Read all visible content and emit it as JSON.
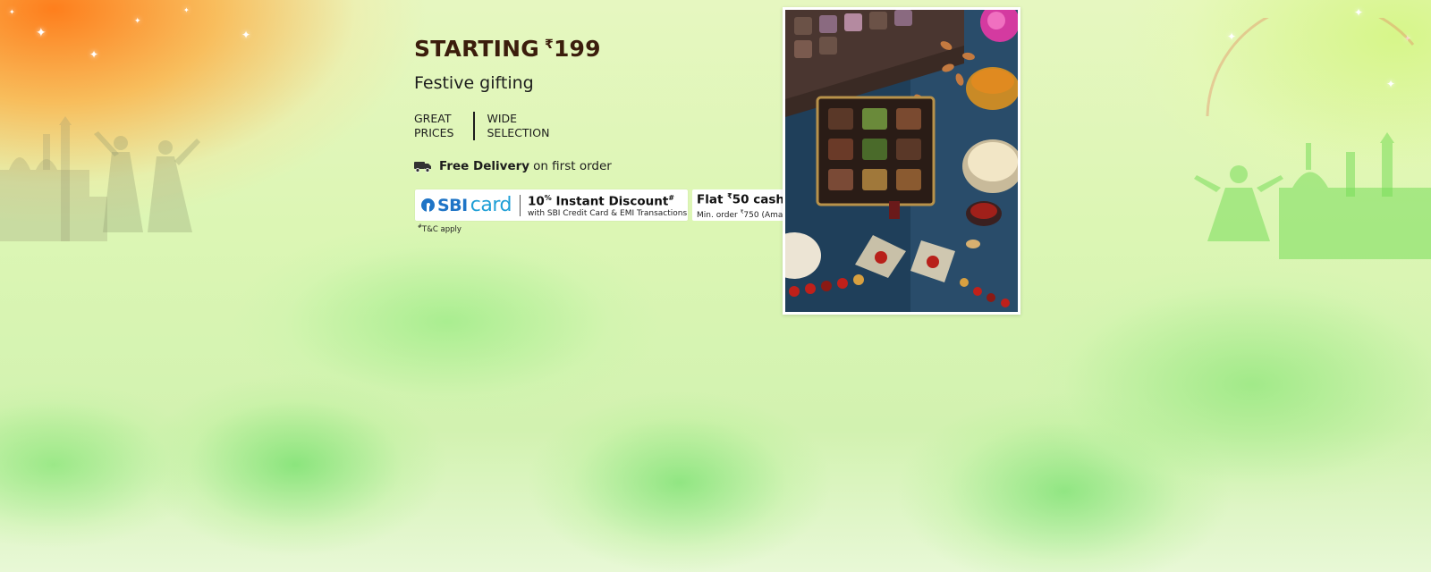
{
  "banner": {
    "title": "STARTING",
    "currency_symbol": "₹",
    "price": "199",
    "subtitle": "Festive gifting",
    "features": [
      {
        "line1": "GREAT",
        "line2": "PRICES"
      },
      {
        "line1": "WIDE",
        "line2": "SELECTION"
      }
    ],
    "delivery": {
      "bold": "Free Delivery",
      "rest": "on first order",
      "icon": "delivery-truck-icon"
    },
    "sbi_offer": {
      "logo_sbi": "SBI",
      "logo_card": "card",
      "headline_value": "10",
      "headline_unit": "%",
      "headline_text": "Instant Discount",
      "headline_mark": "#",
      "detail": "with SBI Credit Card & EMI Transactions",
      "brand_color": "#1f74c6"
    },
    "cashback_offer": {
      "prefix": "Flat",
      "currency_symbol": "₹",
      "amount": "50",
      "suffix": "cashback",
      "detail_prefix": "Min. order",
      "detail_amount": "750",
      "detail_suffix": "(Amazon Pay UPI)"
    },
    "terms": {
      "mark": "#",
      "text": "T&C apply"
    },
    "product_image": "festive-gift-hamper-image"
  },
  "colors": {
    "title": "#3b1d0c",
    "text": "#1d1d1d",
    "orange_glow": "#ff7814",
    "green_glow": "#78e16e"
  }
}
